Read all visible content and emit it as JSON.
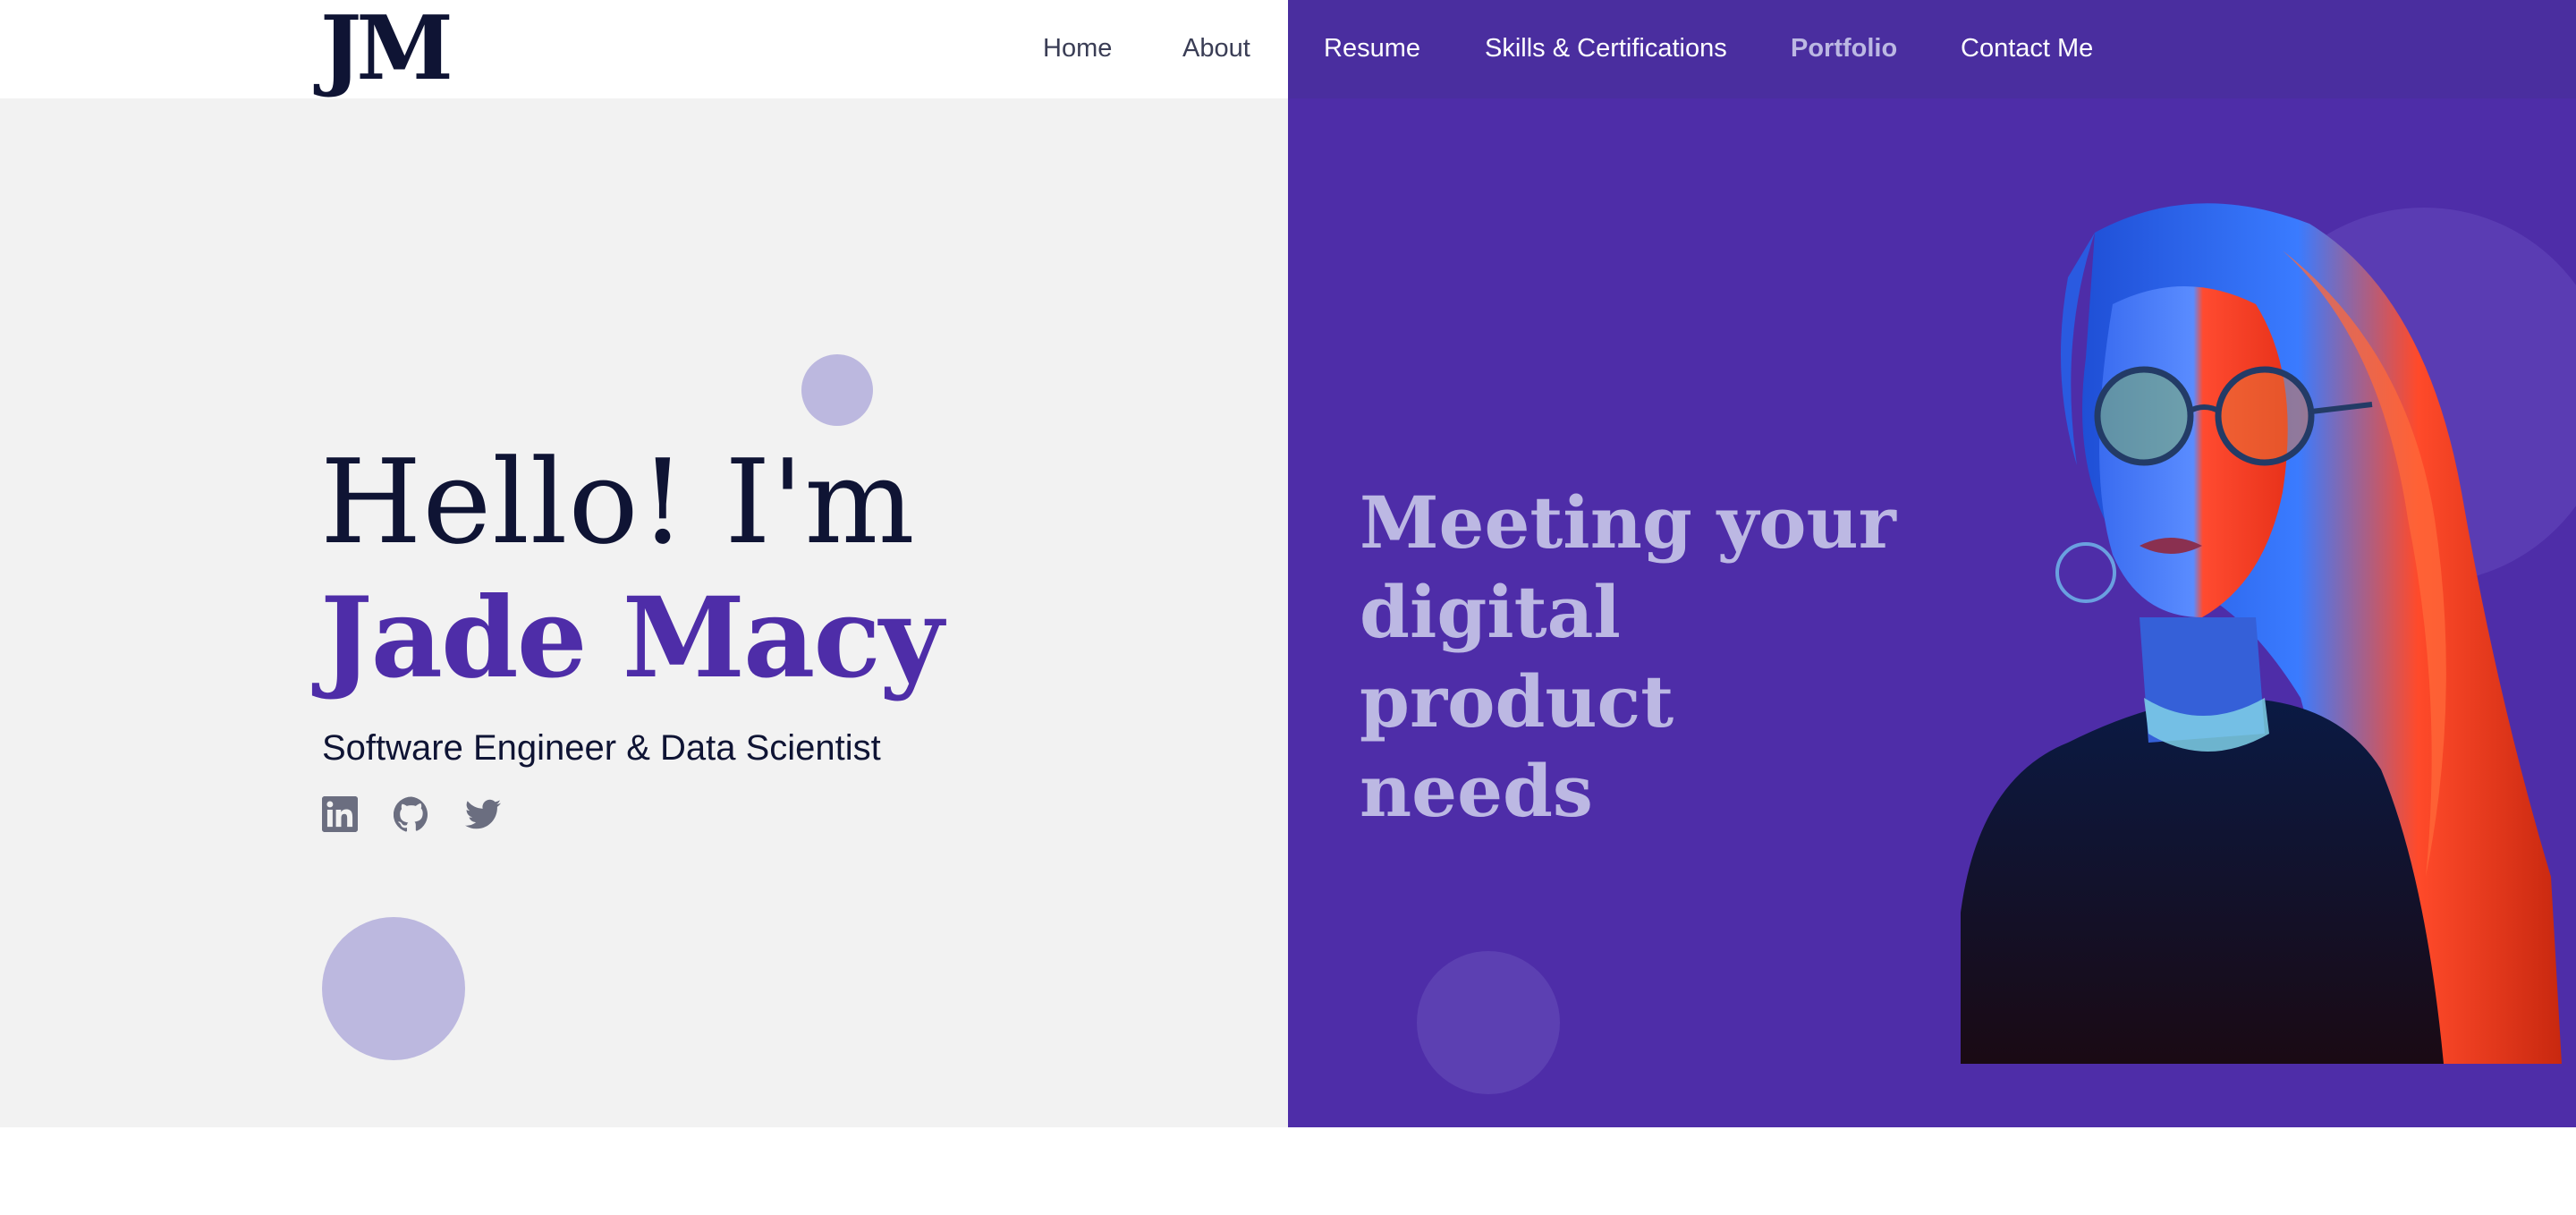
{
  "logo": {
    "text": "JM"
  },
  "nav": {
    "items": [
      {
        "label": "Home"
      },
      {
        "label": "About"
      },
      {
        "label": "Resume"
      },
      {
        "label": "Skills & Certifications"
      },
      {
        "label": "Portfolio",
        "active": true
      },
      {
        "label": "Contact Me"
      }
    ]
  },
  "hero": {
    "greeting": "Hello! I'm",
    "name": "Jade Macy",
    "tagline": "Software Engineer & Data Scientist",
    "social": [
      {
        "icon": "linkedin-icon"
      },
      {
        "icon": "github-icon"
      },
      {
        "icon": "twitter-icon"
      }
    ],
    "slogan": "Meeting your digital product needs"
  },
  "colors": {
    "brand_purple": "#4e2da8",
    "light_lavender": "#bcb8df",
    "navy": "#0f1434",
    "left_bg": "#f2f2f2",
    "social_icon": "#6b6e80"
  }
}
